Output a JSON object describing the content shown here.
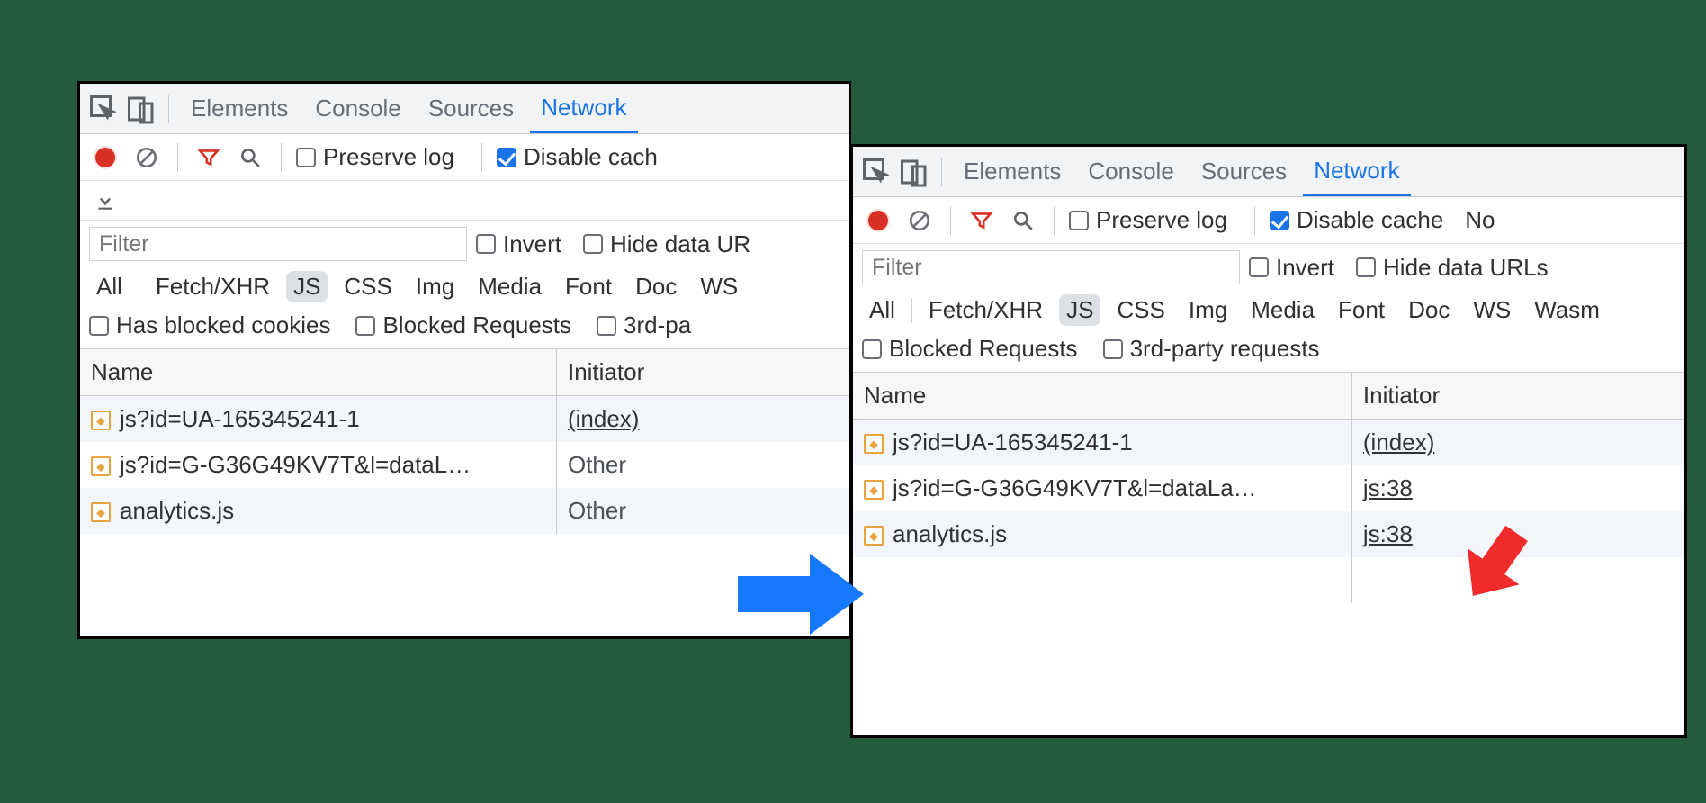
{
  "tabs": {
    "elements": "Elements",
    "console": "Console",
    "sources": "Sources",
    "network": "Network"
  },
  "toolbar": {
    "preserve_log": "Preserve log",
    "disable_cache": "Disable cache",
    "disable_cache_cut_left": "Disable cach",
    "no_cut_right": "No"
  },
  "filter": {
    "placeholder": "Filter",
    "invert": "Invert",
    "hide_data_urls_cut_left": "Hide data UR",
    "hide_data_urls_right": "Hide data URLs"
  },
  "type_chips": [
    "All",
    "Fetch/XHR",
    "JS",
    "CSS",
    "Img",
    "Media",
    "Font",
    "Doc",
    "WS",
    "Wasm"
  ],
  "type_active": "JS",
  "extra_left": {
    "has_blocked_cookies": "Has blocked cookies",
    "blocked_requests": "Blocked Requests",
    "third_party_cut": "3rd-pa"
  },
  "extra_right": {
    "blocked_requests": "Blocked Requests",
    "third_party": "3rd-party requests"
  },
  "table": {
    "headers": {
      "name": "Name",
      "initiator": "Initiator"
    },
    "rows_left": [
      {
        "name": "js?id=UA-165345241-1",
        "initiator": "(index)",
        "link": true
      },
      {
        "name": "js?id=G-G36G49KV7T&l=dataL…",
        "initiator": "Other",
        "link": false
      },
      {
        "name": "analytics.js",
        "initiator": "Other",
        "link": false
      }
    ],
    "rows_right": [
      {
        "name": "js?id=UA-165345241-1",
        "initiator": "(index)",
        "link": true
      },
      {
        "name": "js?id=G-G36G49KV7T&l=dataLa…",
        "initiator": "js:38",
        "link": true
      },
      {
        "name": "analytics.js",
        "initiator": "js:38",
        "link": true
      }
    ]
  }
}
